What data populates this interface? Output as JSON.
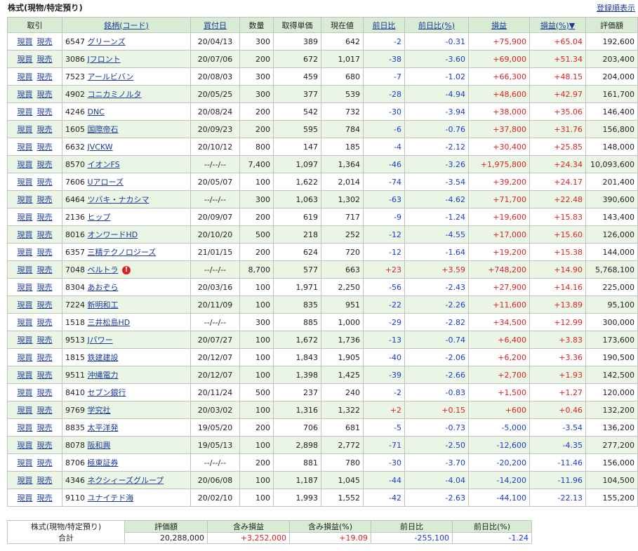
{
  "page": {
    "title": "株式(現物/特定預り)",
    "sort_link": "登録順表示"
  },
  "columns": [
    "取引",
    "銘柄(コード)",
    "買付日",
    "数量",
    "取得単価",
    "現在値",
    "前日比",
    "前日比(%)",
    "損益",
    "損益(%)▼",
    "評価額"
  ],
  "action_labels": {
    "buy": "現買",
    "sell": "現売"
  },
  "rows": [
    {
      "code": "6547",
      "name": "グリーンズ",
      "date": "20/04/13",
      "qty": "300",
      "cost": "389",
      "price": "642",
      "chg": "-2",
      "chg_pct": "-0.31",
      "pl": "+75,900",
      "pl_pct": "+65.04",
      "value": "192,600"
    },
    {
      "code": "3086",
      "name": "Jフロント",
      "date": "20/07/06",
      "qty": "200",
      "cost": "672",
      "price": "1,017",
      "chg": "-38",
      "chg_pct": "-3.60",
      "pl": "+69,000",
      "pl_pct": "+51.34",
      "value": "203,400"
    },
    {
      "code": "7523",
      "name": "アールビバン",
      "date": "20/08/03",
      "qty": "300",
      "cost": "459",
      "price": "680",
      "chg": "-7",
      "chg_pct": "-1.02",
      "pl": "+66,300",
      "pl_pct": "+48.15",
      "value": "204,000"
    },
    {
      "code": "4902",
      "name": "コニカミノルタ",
      "date": "20/05/25",
      "qty": "300",
      "cost": "377",
      "price": "539",
      "chg": "-28",
      "chg_pct": "-4.94",
      "pl": "+48,600",
      "pl_pct": "+42.97",
      "value": "161,700"
    },
    {
      "code": "4246",
      "name": "DNC",
      "date": "20/08/24",
      "qty": "200",
      "cost": "542",
      "price": "732",
      "chg": "-30",
      "chg_pct": "-3.94",
      "pl": "+38,000",
      "pl_pct": "+35.06",
      "value": "146,400"
    },
    {
      "code": "1605",
      "name": "国際帝石",
      "date": "20/09/23",
      "qty": "200",
      "cost": "595",
      "price": "784",
      "chg": "-6",
      "chg_pct": "-0.76",
      "pl": "+37,800",
      "pl_pct": "+31.76",
      "value": "156,800"
    },
    {
      "code": "6632",
      "name": "JVCKW",
      "date": "20/10/12",
      "qty": "800",
      "cost": "147",
      "price": "185",
      "chg": "-4",
      "chg_pct": "-2.12",
      "pl": "+30,400",
      "pl_pct": "+25.85",
      "value": "148,000"
    },
    {
      "code": "8570",
      "name": "イオンFS",
      "date": "--/--/--",
      "qty": "7,400",
      "cost": "1,097",
      "price": "1,364",
      "chg": "-46",
      "chg_pct": "-3.26",
      "pl": "+1,975,800",
      "pl_pct": "+24.34",
      "value": "10,093,600"
    },
    {
      "code": "7606",
      "name": "Uアローズ",
      "date": "20/05/07",
      "qty": "100",
      "cost": "1,622",
      "price": "2,014",
      "chg": "-74",
      "chg_pct": "-3.54",
      "pl": "+39,200",
      "pl_pct": "+24.17",
      "value": "201,400"
    },
    {
      "code": "6464",
      "name": "ツバキ・ナカシマ",
      "date": "--/--/--",
      "qty": "300",
      "cost": "1,063",
      "price": "1,302",
      "chg": "-63",
      "chg_pct": "-4.62",
      "pl": "+71,700",
      "pl_pct": "+22.48",
      "value": "390,600"
    },
    {
      "code": "2136",
      "name": "ヒップ",
      "date": "20/09/07",
      "qty": "200",
      "cost": "619",
      "price": "717",
      "chg": "-9",
      "chg_pct": "-1.24",
      "pl": "+19,600",
      "pl_pct": "+15.83",
      "value": "143,400"
    },
    {
      "code": "8016",
      "name": "オンワードHD",
      "date": "20/10/20",
      "qty": "500",
      "cost": "218",
      "price": "252",
      "chg": "-12",
      "chg_pct": "-4.55",
      "pl": "+17,000",
      "pl_pct": "+15.60",
      "value": "126,000"
    },
    {
      "code": "6357",
      "name": "三精テクノロジーズ",
      "date": "21/01/15",
      "qty": "200",
      "cost": "624",
      "price": "720",
      "chg": "-12",
      "chg_pct": "-1.64",
      "pl": "+19,200",
      "pl_pct": "+15.38",
      "value": "144,000"
    },
    {
      "code": "7048",
      "name": "ベルトラ",
      "warn": "!",
      "date": "--/--/--",
      "qty": "8,700",
      "cost": "577",
      "price": "663",
      "chg": "+23",
      "chg_pct": "+3.59",
      "pl": "+748,200",
      "pl_pct": "+14.90",
      "value": "5,768,100"
    },
    {
      "code": "8304",
      "name": "あおぞら",
      "date": "20/03/16",
      "qty": "100",
      "cost": "1,971",
      "price": "2,250",
      "chg": "-56",
      "chg_pct": "-2.43",
      "pl": "+27,900",
      "pl_pct": "+14.16",
      "value": "225,000"
    },
    {
      "code": "7224",
      "name": "新明和工",
      "date": "20/11/09",
      "qty": "100",
      "cost": "835",
      "price": "951",
      "chg": "-22",
      "chg_pct": "-2.26",
      "pl": "+11,600",
      "pl_pct": "+13.89",
      "value": "95,100"
    },
    {
      "code": "1518",
      "name": "三井松島HD",
      "date": "--/--/--",
      "qty": "300",
      "cost": "885",
      "price": "1,000",
      "chg": "-29",
      "chg_pct": "-2.82",
      "pl": "+34,500",
      "pl_pct": "+12.99",
      "value": "300,000"
    },
    {
      "code": "9513",
      "name": "Jパワー",
      "date": "20/07/27",
      "qty": "100",
      "cost": "1,672",
      "price": "1,736",
      "chg": "-13",
      "chg_pct": "-0.74",
      "pl": "+6,400",
      "pl_pct": "+3.83",
      "value": "173,600"
    },
    {
      "code": "1815",
      "name": "鉄建建設",
      "date": "20/12/07",
      "qty": "100",
      "cost": "1,843",
      "price": "1,905",
      "chg": "-40",
      "chg_pct": "-2.06",
      "pl": "+6,200",
      "pl_pct": "+3.36",
      "value": "190,500"
    },
    {
      "code": "9511",
      "name": "沖縄電力",
      "date": "20/12/07",
      "qty": "100",
      "cost": "1,398",
      "price": "1,425",
      "chg": "-39",
      "chg_pct": "-2.66",
      "pl": "+2,700",
      "pl_pct": "+1.93",
      "value": "142,500"
    },
    {
      "code": "8410",
      "name": "セブン銀行",
      "date": "20/11/24",
      "qty": "500",
      "cost": "237",
      "price": "240",
      "chg": "-2",
      "chg_pct": "-0.83",
      "pl": "+1,500",
      "pl_pct": "+1.27",
      "value": "120,000"
    },
    {
      "code": "9769",
      "name": "学究社",
      "date": "20/03/02",
      "qty": "100",
      "cost": "1,316",
      "price": "1,322",
      "chg": "+2",
      "chg_pct": "+0.15",
      "pl": "+600",
      "pl_pct": "+0.46",
      "value": "132,200"
    },
    {
      "code": "8835",
      "name": "太平洋発",
      "date": "19/05/20",
      "qty": "200",
      "cost": "706",
      "price": "681",
      "chg": "-5",
      "chg_pct": "-0.73",
      "pl": "-5,000",
      "pl_pct": "-3.54",
      "value": "136,200"
    },
    {
      "code": "8078",
      "name": "阪和興",
      "date": "19/05/13",
      "qty": "100",
      "cost": "2,898",
      "price": "2,772",
      "chg": "-71",
      "chg_pct": "-2.50",
      "pl": "-12,600",
      "pl_pct": "-4.35",
      "value": "277,200"
    },
    {
      "code": "8706",
      "name": "極東証券",
      "date": "--/--/--",
      "qty": "200",
      "cost": "881",
      "price": "780",
      "chg": "-30",
      "chg_pct": "-3.70",
      "pl": "-20,200",
      "pl_pct": "-11.46",
      "value": "156,000"
    },
    {
      "code": "4346",
      "name": "ネクシィーズグループ",
      "date": "20/06/08",
      "qty": "100",
      "cost": "1,187",
      "price": "1,045",
      "chg": "-44",
      "chg_pct": "-4.04",
      "pl": "-14,200",
      "pl_pct": "-11.96",
      "value": "104,500"
    },
    {
      "code": "9110",
      "name": "ユナイテド海",
      "date": "20/02/10",
      "qty": "100",
      "cost": "1,993",
      "price": "1,552",
      "chg": "-42",
      "chg_pct": "-2.63",
      "pl": "-44,100",
      "pl_pct": "-22.13",
      "value": "155,200"
    }
  ],
  "summary": {
    "label_line1": "株式(現物/特定預り)",
    "label_line2": "合計",
    "headers": [
      "評価額",
      "含み損益",
      "含み損益(%)",
      "前日比",
      "前日比(%)"
    ],
    "values": [
      "20,288,000",
      "+3,252,000",
      "+19.09",
      "-255,100",
      "-1.24"
    ]
  },
  "colors": {
    "header_bg": "#d7ecd2",
    "row_alt_bg": "#eaf5e5",
    "link": "#1a3a9a",
    "plus": "#e02020",
    "minus": "#1a3ad0"
  }
}
